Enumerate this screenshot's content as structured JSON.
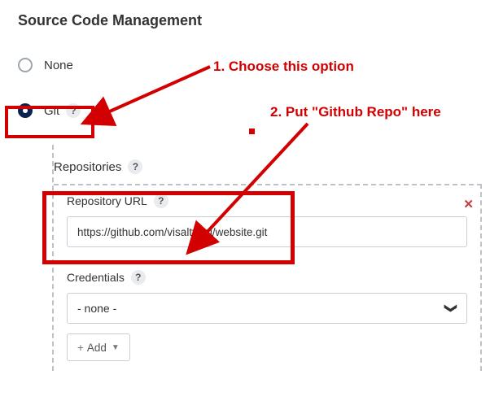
{
  "section": {
    "title": "Source Code Management"
  },
  "scm": {
    "none_label": "None",
    "git_label": "Git"
  },
  "repositories": {
    "heading": "Repositories",
    "url_label": "Repository URL",
    "url_value": "https://github.com/visaltyagi/website.git",
    "credentials_label": "Credentials",
    "credentials_value": "- none -",
    "add_label": "Add",
    "close_glyph": "✕"
  },
  "annotations": {
    "step1": "1. Choose this option",
    "step2": "2. Put \"Github Repo\" here"
  },
  "glyphs": {
    "help": "?",
    "chevron_down": "❯",
    "plus": "+",
    "caret_down": "▼"
  }
}
